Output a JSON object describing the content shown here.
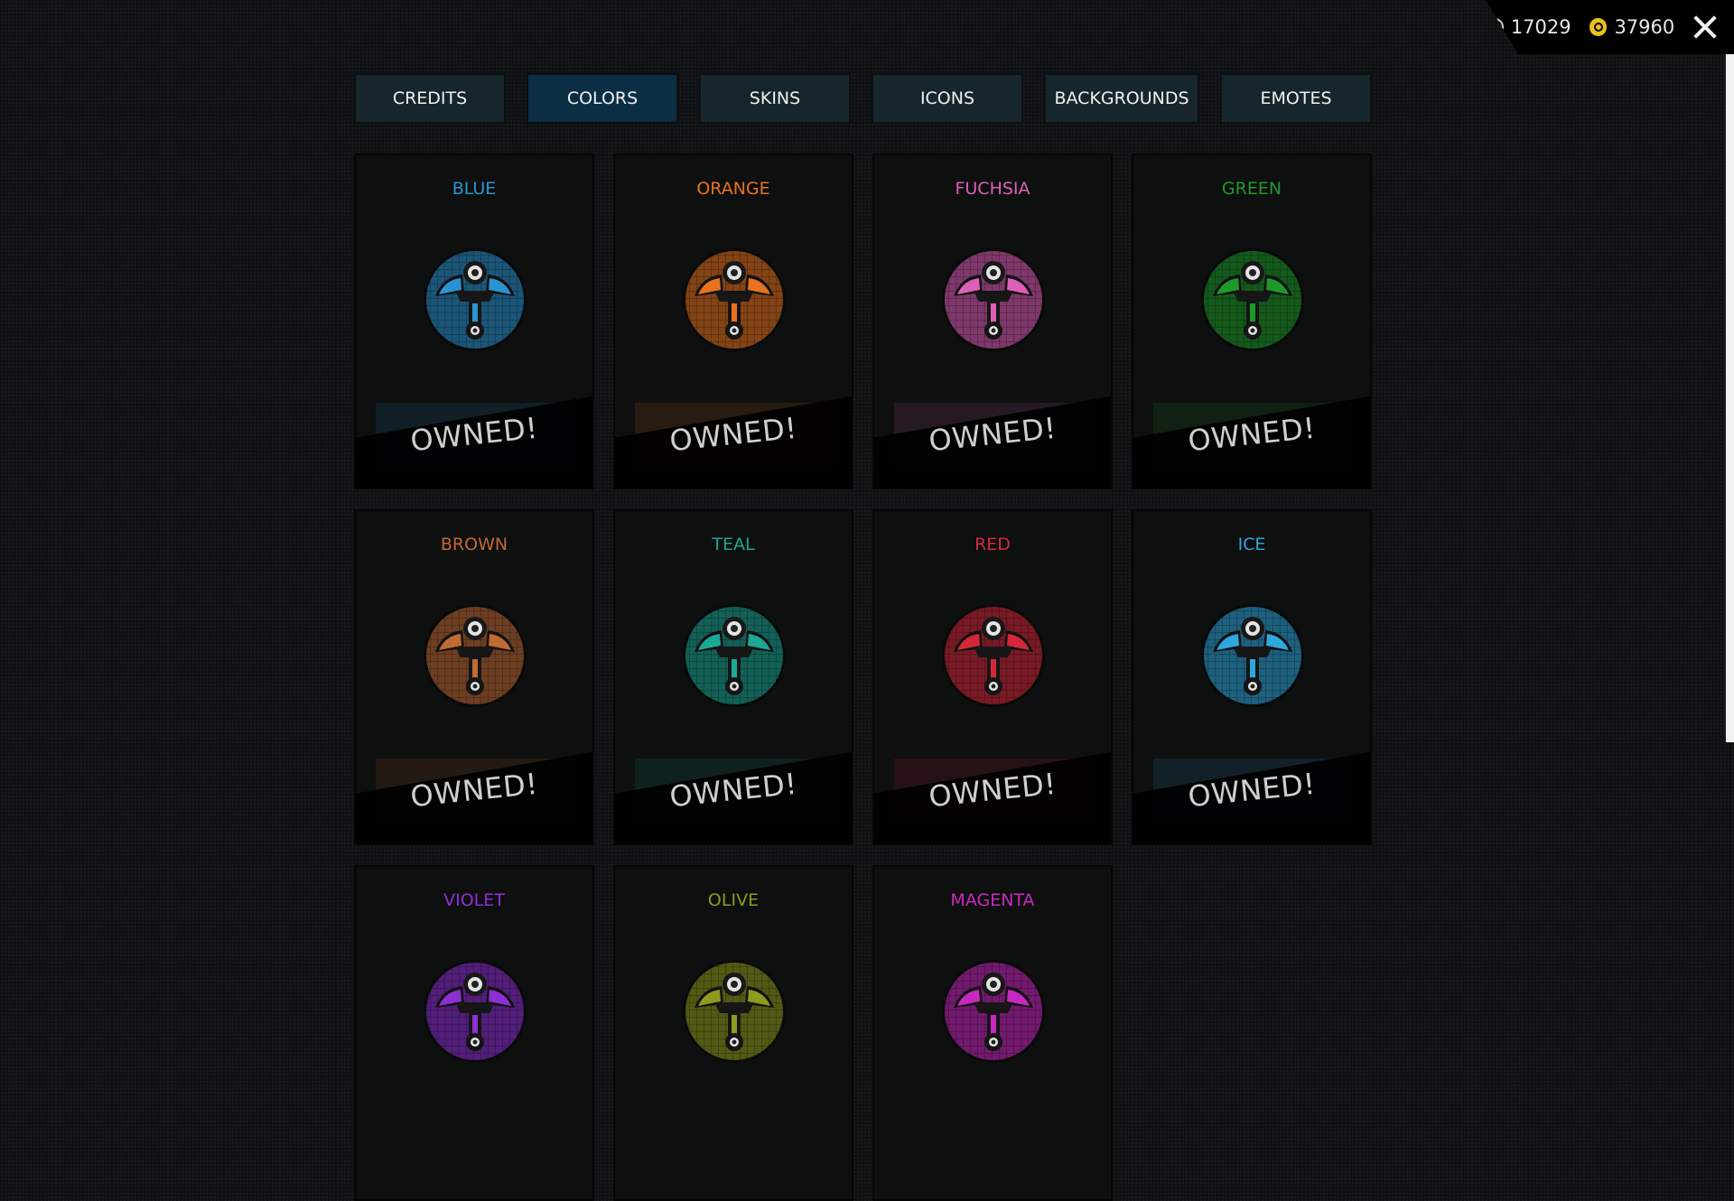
{
  "currency": {
    "silver_value": "17029",
    "gold_value": "37960",
    "silver_icon": "silver-coin-icon",
    "gold_icon": "gold-coin-icon"
  },
  "tabs": [
    {
      "label": "CREDITS",
      "active": false
    },
    {
      "label": "COLORS",
      "active": true
    },
    {
      "label": "SKINS",
      "active": false
    },
    {
      "label": "ICONS",
      "active": false
    },
    {
      "label": "BACKGROUNDS",
      "active": false
    },
    {
      "label": "EMOTES",
      "active": false
    }
  ],
  "cards": [
    {
      "name": "BLUE",
      "color": "#2a94d2",
      "owned": "OWNED!"
    },
    {
      "name": "ORANGE",
      "color": "#e8721f",
      "owned": "OWNED!"
    },
    {
      "name": "FUCHSIA",
      "color": "#de5fba",
      "owned": "OWNED!"
    },
    {
      "name": "GREEN",
      "color": "#1e9a2a",
      "owned": "OWNED!"
    },
    {
      "name": "BROWN",
      "color": "#c06a34",
      "owned": "OWNED!"
    },
    {
      "name": "TEAL",
      "color": "#1ca896",
      "owned": "OWNED!"
    },
    {
      "name": "RED",
      "color": "#d4283a",
      "owned": "OWNED!"
    },
    {
      "name": "ICE",
      "color": "#2ea7dc",
      "owned": "OWNED!"
    },
    {
      "name": "VIOLET",
      "color": "#8d2fd3",
      "owned": ""
    },
    {
      "name": "OLIVE",
      "color": "#8f9a1e",
      "owned": ""
    },
    {
      "name": "MAGENTA",
      "color": "#c928c0",
      "owned": ""
    }
  ]
}
